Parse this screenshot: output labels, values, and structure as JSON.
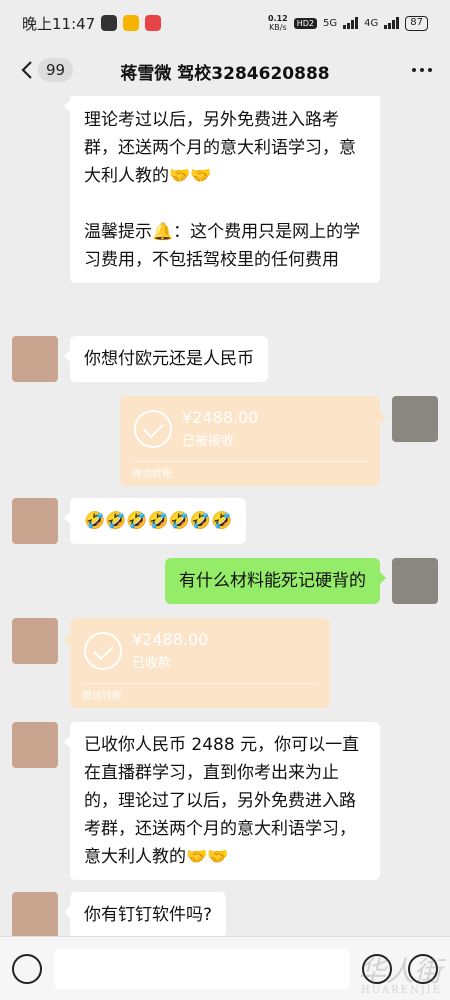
{
  "status_bar": {
    "time": "晚上11:47",
    "net_speed_value": "0.12",
    "net_speed_unit": "KB/s",
    "hd_label": "HD2",
    "net_5g": "5G",
    "net_4g": "4G",
    "battery": "87"
  },
  "header": {
    "unread_count": "99",
    "title": "蒋雪微 驾校3284620888"
  },
  "messages": {
    "m1": {
      "p1": "理论考过以后，另外免费进入路考群，还送两个月的意大利语学习，意大利人教的🤝🤝",
      "p2": "温馨提示🔔：这个费用只是网上的学习费用，不包括驾校里的任何费用"
    },
    "m2": "你想付欧元还是人民币",
    "m3_transfer": {
      "amount": "¥2488.00",
      "status": "已被接收",
      "brand": "微信转账"
    },
    "m4": "🤣🤣🤣🤣🤣🤣🤣",
    "m5": "有什么材料能死记硬背的",
    "m6_transfer": {
      "amount": "¥2488.00",
      "status": "已收款",
      "brand": "微信转账"
    },
    "m7": "已收你人民币 2488 元，你可以一直在直播群学习，直到你考出来为止的，理论过了以后，另外免费进入路考群，还送两个月的意大利语学习，意大利人教的🤝🤝",
    "m8": "你有钉钉软件吗?"
  },
  "input_bar": {
    "message_value": ""
  },
  "watermark": {
    "cn": "华人街",
    "en": "HUARENJIE"
  },
  "colors": {
    "chat_bg": "#ededed",
    "sent_bubble": "#95ec69",
    "received_bubble": "#ffffff",
    "transfer_card": "#fbe4c7"
  }
}
